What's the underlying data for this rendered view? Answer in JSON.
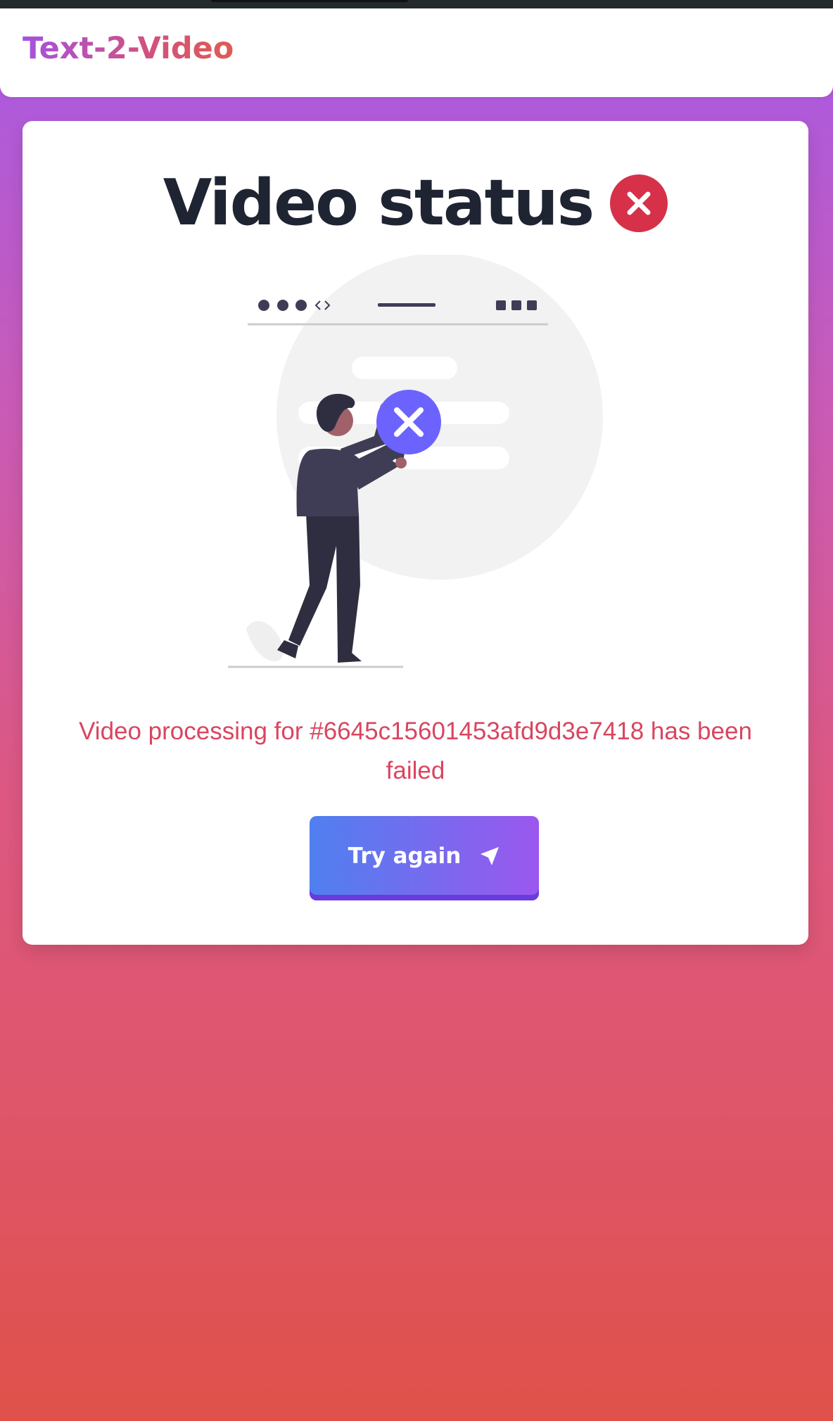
{
  "app": {
    "brand": "Text-2-Video"
  },
  "status": {
    "title": "Video status",
    "state_icon": "error-x-icon",
    "message": "Video processing for #6645c15601453afd9d3e7418 has been failed",
    "retry_label": "Try again",
    "retry_icon": "send-arrow-icon"
  },
  "colors": {
    "error": "#d63149",
    "accent": "#6c63ff",
    "button_start": "#4f80ef",
    "button_end": "#9b57ef",
    "title": "#1f2433",
    "message": "#d94560"
  }
}
